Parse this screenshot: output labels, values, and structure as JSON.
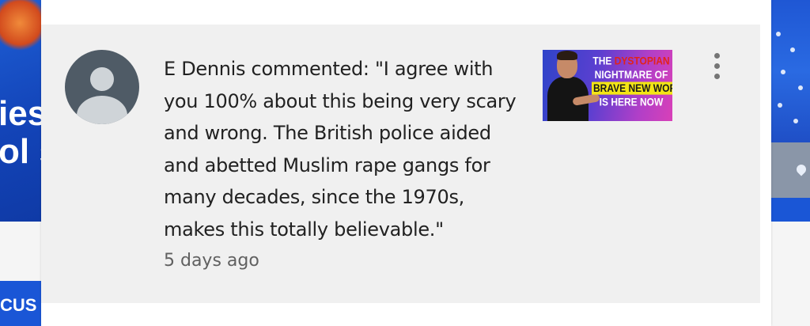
{
  "background": {
    "left_text": "ies\nol s",
    "left_bar_text": "CUS"
  },
  "notification": {
    "message": "E Dennis commented: \"I agree with you 100% about this being very scary and wrong. The British police aided and abetted Muslim rape gangs for many decades, since the 1970s, makes this totally believable.\"",
    "timestamp": "5 days ago",
    "thumbnail": {
      "line1_white": "THE ",
      "line1_red": "DYSTOPIAN",
      "line2": "NIGHTMARE OF",
      "line3": "BRAVE NEW WORLD",
      "line4": "IS HERE NOW"
    },
    "menu_icon": "more-vert-icon"
  },
  "colors": {
    "notification_bg": "#f0f0f0",
    "avatar_bg": "#4f5b66",
    "text": "#212121",
    "timestamp": "#606060",
    "accent_blue": "#1a56d6"
  }
}
